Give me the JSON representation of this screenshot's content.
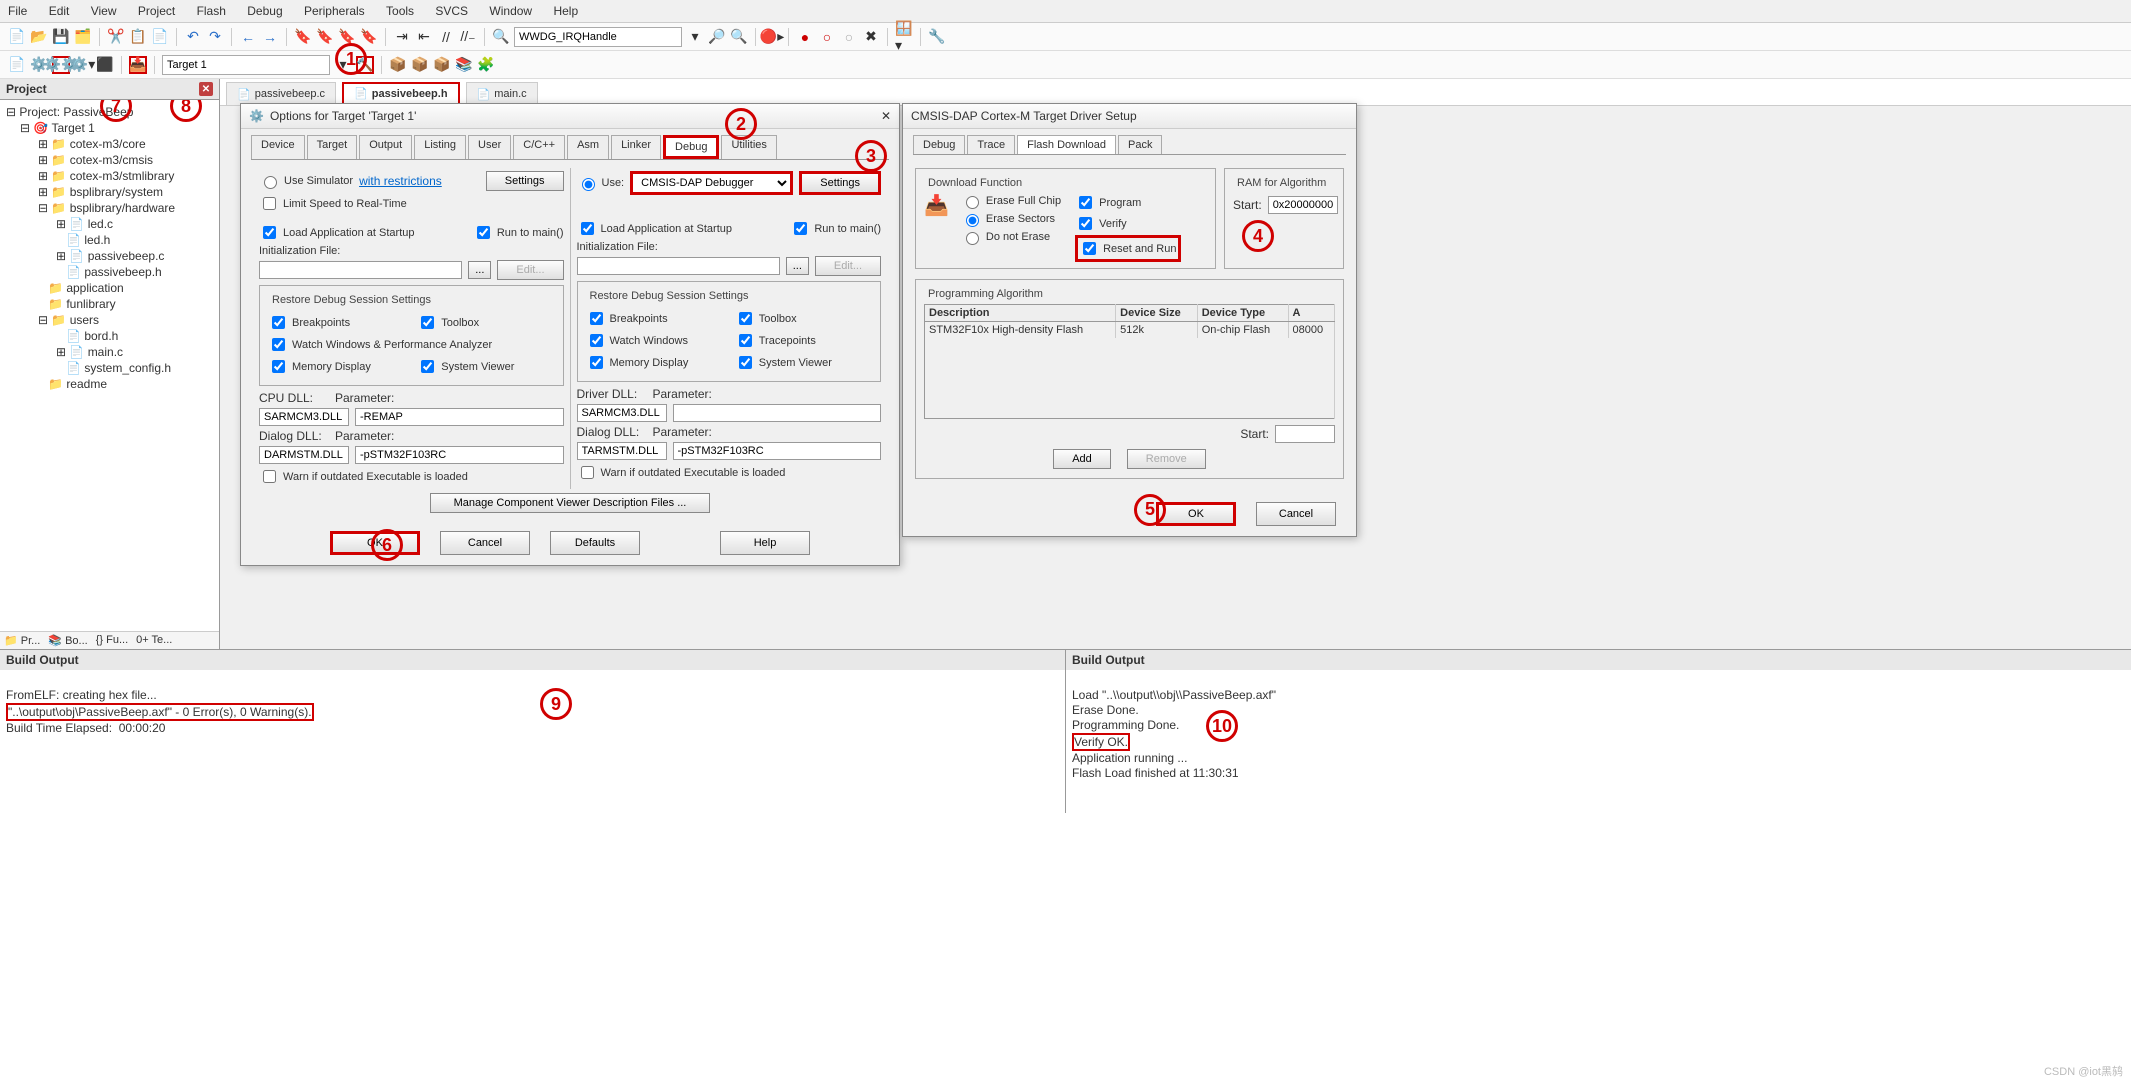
{
  "menubar": [
    "File",
    "Edit",
    "View",
    "Project",
    "Flash",
    "Debug",
    "Peripherals",
    "Tools",
    "SVCS",
    "Window",
    "Help"
  ],
  "toolbar1": {
    "combo": "WWDG_IRQHandle"
  },
  "toolbar2": {
    "target": "Target 1"
  },
  "project": {
    "title": "Project",
    "root": "Project: PassiveBeep",
    "target": "Target 1",
    "folders": [
      {
        "name": "cotex-m3/core",
        "depth": 3
      },
      {
        "name": "cotex-m3/cmsis",
        "depth": 3
      },
      {
        "name": "cotex-m3/stmlibrary",
        "depth": 3
      },
      {
        "name": "bsplibrary/system",
        "depth": 3
      },
      {
        "name": "bsplibrary/hardware",
        "depth": 3,
        "expanded": true,
        "files": [
          "led.c",
          "led.h",
          "passivebeep.c",
          "passivebeep.h"
        ]
      },
      {
        "name": "application",
        "depth": 3
      },
      {
        "name": "funlibrary",
        "depth": 3
      },
      {
        "name": "users",
        "depth": 3,
        "expanded": true,
        "files": [
          "bord.h",
          "main.c",
          "system_config.h"
        ]
      },
      {
        "name": "readme",
        "depth": 3
      }
    ],
    "tabs": [
      "Pr...",
      "Bo...",
      "Fu...",
      "Te..."
    ]
  },
  "fileTabs": [
    {
      "name": "passivebeep.c",
      "active": false
    },
    {
      "name": "passivebeep.h",
      "active": true
    },
    {
      "name": "main.c",
      "active": false
    }
  ],
  "optionsDialog": {
    "title": "Options for Target 'Target 1'",
    "tabs": [
      "Device",
      "Target",
      "Output",
      "Listing",
      "User",
      "C/C++",
      "Asm",
      "Linker",
      "Debug",
      "Utilities"
    ],
    "activeTab": "Debug",
    "left": {
      "useSim": "Use Simulator",
      "restrictions": "with restrictions",
      "settings": "Settings",
      "limitSpeed": "Limit Speed to Real-Time",
      "loadApp": "Load Application at Startup",
      "runMain": "Run to main()",
      "initFile": "Initialization File:",
      "edit": "Edit...",
      "restore": "Restore Debug Session Settings",
      "bp": "Breakpoints",
      "tb": "Toolbox",
      "ww": "Watch Windows & Performance Analyzer",
      "md": "Memory Display",
      "sv": "System Viewer",
      "cpudll": "CPU DLL:",
      "param": "Parameter:",
      "cpudll_v": "SARMCM3.DLL",
      "cpuparam_v": "-REMAP",
      "dlgdll": "Dialog DLL:",
      "dlgdll_v": "DARMSTM.DLL",
      "dlgparam_v": "-pSTM32F103RC",
      "warn": "Warn if outdated Executable is loaded"
    },
    "right": {
      "use": "Use:",
      "debugger": "CMSIS-DAP Debugger",
      "settings": "Settings",
      "loadApp": "Load Application at Startup",
      "runMain": "Run to main()",
      "initFile": "Initialization File:",
      "edit": "Edit...",
      "restore": "Restore Debug Session Settings",
      "bp": "Breakpoints",
      "tb": "Toolbox",
      "ww": "Watch Windows",
      "tp": "Tracepoints",
      "md": "Memory Display",
      "sv": "System Viewer",
      "drvdll": "Driver DLL:",
      "param": "Parameter:",
      "drvdll_v": "SARMCM3.DLL",
      "dlgdll": "Dialog DLL:",
      "dlgdll_v": "TARMSTM.DLL",
      "dlgparam_v": "-pSTM32F103RC",
      "warn": "Warn if outdated Executable is loaded"
    },
    "manage": "Manage Component Viewer Description Files ...",
    "ok": "OK",
    "cancel": "Cancel",
    "defaults": "Defaults",
    "help": "Help"
  },
  "cmsisDialog": {
    "title": "CMSIS-DAP Cortex-M Target Driver Setup",
    "tabs": [
      "Debug",
      "Trace",
      "Flash Download",
      "Pack"
    ],
    "activeTab": "Flash Download",
    "downloadFn": {
      "title": "Download Function",
      "eraseFull": "Erase Full Chip",
      "eraseSectors": "Erase Sectors",
      "noErase": "Do not Erase",
      "program": "Program",
      "verify": "Verify",
      "resetRun": "Reset and Run"
    },
    "ram": {
      "title": "RAM for Algorithm",
      "start": "Start:",
      "start_v": "0x20000000"
    },
    "progAlg": {
      "title": "Programming Algorithm",
      "headers": [
        "Description",
        "Device Size",
        "Device Type",
        "A"
      ],
      "row": [
        "STM32F10x High-density Flash",
        "512k",
        "On-chip Flash",
        "08000"
      ]
    },
    "start": "Start:",
    "add": "Add",
    "remove": "Remove",
    "ok": "OK",
    "cancel": "Cancel"
  },
  "buildOutput1": {
    "title": "Build Output",
    "line1": "FromELF: creating hex file...",
    "line2": "\"..\\output\\obj\\PassiveBeep.axf\" - 0 Error(s), 0 Warning(s).",
    "line3": "Build Time Elapsed:  00:00:20"
  },
  "buildOutput2": {
    "title": "Build Output",
    "line1": "Load \"..\\\\output\\\\obj\\\\PassiveBeep.axf\"",
    "line2": "Erase Done.",
    "line3": "Programming Done.",
    "line4": "Verify OK.",
    "line5": "Application running ...",
    "line6": "Flash Load finished at 11:30:31"
  },
  "annotations": [
    "1",
    "2",
    "3",
    "4",
    "5",
    "6",
    "7",
    "8",
    "9",
    "10"
  ],
  "watermark": "CSDN @iot黑鸫"
}
